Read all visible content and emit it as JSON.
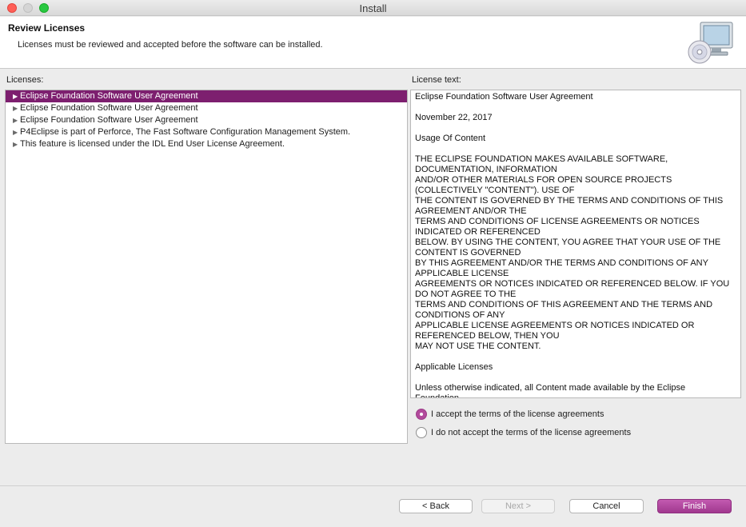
{
  "window": {
    "title": "Install"
  },
  "header": {
    "title": "Review Licenses",
    "description": "Licenses must be reviewed and accepted before the software can be installed."
  },
  "licenses_label": "Licenses:",
  "license_text_label": "License text:",
  "licenses": [
    "Eclipse Foundation Software User Agreement",
    "Eclipse Foundation Software User Agreement",
    "Eclipse Foundation Software User Agreement",
    "P4Eclipse is part of Perforce, The Fast Software Configuration Management System.",
    "This feature is licensed under the IDL End User License Agreement."
  ],
  "license_text_lines": [
    "Eclipse Foundation Software User Agreement",
    "",
    "November 22, 2017",
    "",
    "Usage Of Content",
    "",
    "THE ECLIPSE FOUNDATION MAKES AVAILABLE SOFTWARE,",
    "DOCUMENTATION, INFORMATION",
    "AND/OR OTHER MATERIALS FOR OPEN SOURCE PROJECTS",
    "(COLLECTIVELY \"CONTENT\"). USE OF",
    "THE CONTENT IS GOVERNED BY THE TERMS AND CONDITIONS OF THIS",
    "AGREEMENT AND/OR THE",
    "TERMS AND CONDITIONS OF LICENSE AGREEMENTS OR NOTICES",
    "INDICATED OR REFERENCED",
    "BELOW. BY USING THE CONTENT, YOU AGREE THAT YOUR USE OF THE",
    "CONTENT IS GOVERNED",
    "BY THIS AGREEMENT AND/OR THE TERMS AND CONDITIONS OF ANY",
    "APPLICABLE LICENSE",
    "AGREEMENTS OR NOTICES INDICATED OR REFERENCED BELOW. IF YOU",
    "DO NOT AGREE TO THE",
    "TERMS AND CONDITIONS OF THIS AGREEMENT AND THE TERMS AND",
    "CONDITIONS OF ANY",
    "APPLICABLE LICENSE AGREEMENTS OR NOTICES INDICATED OR",
    "REFERENCED BELOW, THEN YOU",
    "MAY NOT USE THE CONTENT.",
    "",
    "Applicable Licenses",
    "",
    "Unless otherwise indicated, all Content made available by the Eclipse",
    "Foundation"
  ],
  "options": {
    "accept": "I accept the terms of the license agreements",
    "decline": "I do not accept the terms of the license agreements",
    "selected": "accept"
  },
  "buttons": {
    "back": "< Back",
    "next": "Next >",
    "cancel": "Cancel",
    "finish": "Finish"
  },
  "icons": {
    "expand_arrow": "triangle-right-icon",
    "header_graphic": "computer-cd-icon"
  },
  "colors": {
    "selection": "#7d1f6f",
    "primary_button": "#b24a9c"
  }
}
